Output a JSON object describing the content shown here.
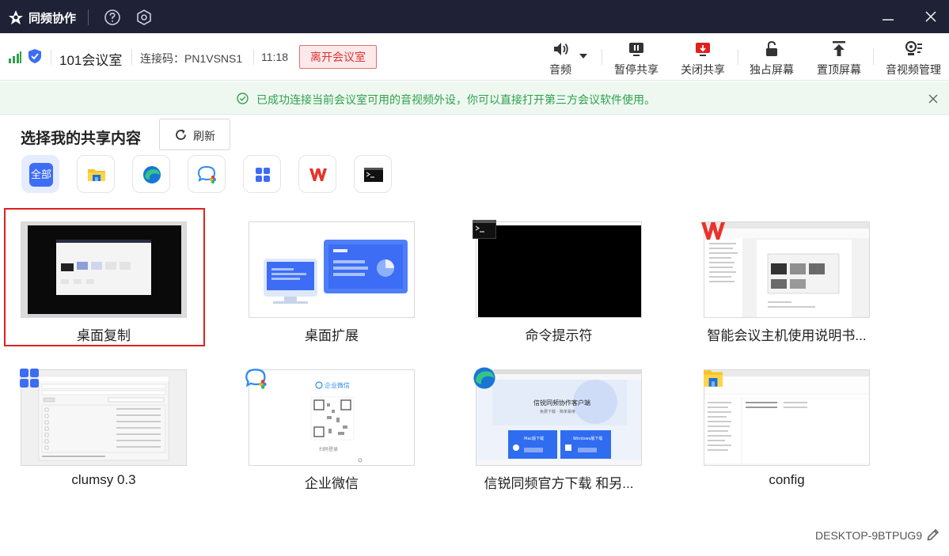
{
  "titlebar": {
    "app_name": "同频协作",
    "icons": [
      "logo-icon",
      "help-icon",
      "settings-icon",
      "minimize-icon",
      "close-icon"
    ]
  },
  "toolbar": {
    "room_name": "101会议室",
    "connection_code": "连接码：PN1VSNS1",
    "time": "11:18",
    "leave_button": "离开会议室",
    "tools": [
      {
        "label": "音频",
        "icon": "speaker-icon"
      },
      {
        "label": "暂停共享",
        "icon": "pause-share-icon"
      },
      {
        "label": "关闭共享",
        "icon": "stop-share-icon"
      },
      {
        "label": "独占屏幕",
        "icon": "lock-screen-icon"
      },
      {
        "label": "置顶屏幕",
        "icon": "pin-top-icon"
      },
      {
        "label": "音视频管理",
        "icon": "av-manage-icon"
      }
    ]
  },
  "notice": {
    "message": "已成功连接当前会议室可用的音视频外设，你可以直接打开第三方会议软件使用。"
  },
  "share": {
    "title": "选择我的共享内容",
    "refresh_label": "刷新",
    "filters": [
      {
        "label": "全部",
        "icon": "all-icon",
        "active": true
      },
      {
        "label": "",
        "icon": "file-explorer-icon"
      },
      {
        "label": "",
        "icon": "edge-icon"
      },
      {
        "label": "",
        "icon": "wecom-icon"
      },
      {
        "label": "",
        "icon": "apps-grid-icon"
      },
      {
        "label": "",
        "icon": "wps-icon"
      },
      {
        "label": "",
        "icon": "terminal-icon"
      }
    ],
    "items": [
      {
        "label": "桌面复制",
        "selected": true
      },
      {
        "label": "桌面扩展"
      },
      {
        "label": "命令提示符"
      },
      {
        "label": "智能会议主机使用说明书..."
      },
      {
        "label": "clumsy 0.3"
      },
      {
        "label": "企业微信"
      },
      {
        "label": "信锐同频官方下载 和另..."
      },
      {
        "label": "config"
      }
    ]
  },
  "thumb_text": {
    "wecom_title": "企业微信",
    "wecom_scan": "扫码登录",
    "site_title": "信锐同频协作客户端",
    "site_sub": "免费下载 · 简单易用",
    "site_btn_mac": "Mac版下载",
    "site_btn_win": "Windows版下载"
  },
  "footer": {
    "hostname": "DESKTOP-9BTPUG9"
  },
  "colors": {
    "titlebar_bg": "#1f2236",
    "accent": "#3d6cf5",
    "danger": "#e02020",
    "success": "#2fa14a"
  }
}
